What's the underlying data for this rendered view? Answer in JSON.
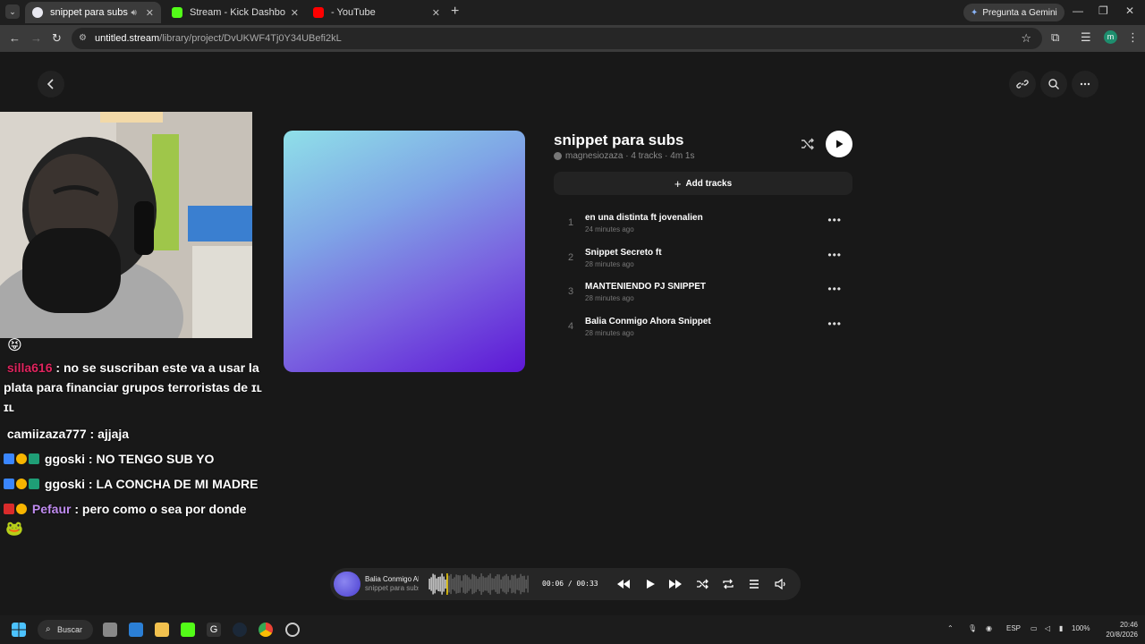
{
  "browser": {
    "tabs": [
      {
        "title": "snippet para subs",
        "active": true
      },
      {
        "title": "Stream - Kick Dashboard",
        "active": false
      },
      {
        "title": "- YouTube",
        "active": false
      }
    ],
    "gemini_label": "Pregunta a Gemini",
    "url_host": "untitled.stream",
    "url_path": "/library/project/DvUKWF4Tj0Y34UBefi2kL",
    "profile_initial": "m"
  },
  "project": {
    "title": "snippet para subs",
    "meta": "magnesiozaza · 4 tracks · 4m 1s",
    "add_tracks_label": "Add tracks",
    "tracks": [
      {
        "num": "1",
        "name": "en una distinta ft jovenalien",
        "time": "24 minutes ago"
      },
      {
        "num": "2",
        "name": "Snippet Secreto ft",
        "time": "28 minutes ago"
      },
      {
        "num": "3",
        "name": "MANTENIENDO PJ SNIPPET",
        "time": "28 minutes ago"
      },
      {
        "num": "4",
        "name": "Balia Conmigo Ahora Snippet",
        "time": "28 minutes ago"
      }
    ]
  },
  "chat": [
    {
      "user": "silla616",
      "user_color": "#e0245e",
      "text": " : no se suscriban este va a usar la plata para financiar grupos terroristas de ɪʟ ɪʟ"
    },
    {
      "user": "camiizaza777",
      "user_color": "#ffffff",
      "text": " : ajjaja"
    },
    {
      "user": "ggoski",
      "user_color": "#ffffff",
      "text": " : NO TENGO SUB YO"
    },
    {
      "user": "ggoski",
      "user_color": "#ffffff",
      "text": " : LA CONCHA DE MI MADRE"
    },
    {
      "user": "Pefaur",
      "user_color": "#c08cf0",
      "text": " : pero como o sea por donde"
    }
  ],
  "player": {
    "title": "Balia Conmigo Ahora Snippet",
    "subtitle": "snippet para subs",
    "time": "00:06 / 00:33",
    "progress": 0.18
  },
  "taskbar": {
    "search_label": "Buscar",
    "lang": "ESP",
    "battery": "100%",
    "time": "20:46",
    "date": "20/8/2026"
  },
  "colors": {
    "background": "#181818",
    "cover_gradient": [
      "#8fe0e8",
      "#5d17d6"
    ]
  }
}
